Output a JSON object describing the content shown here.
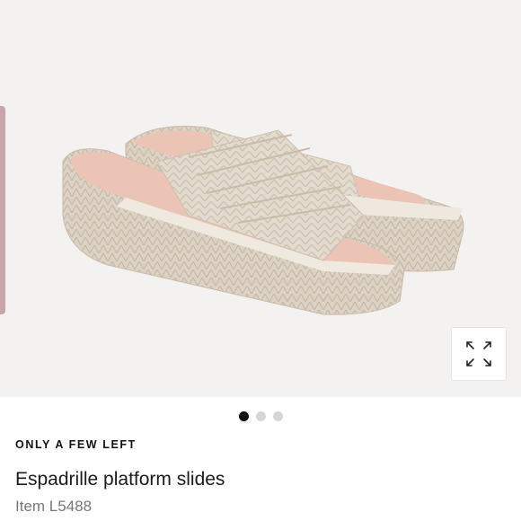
{
  "gallery": {
    "image_alt": "Espadrille platform slides",
    "zoom_icon": "expand-arrows-icon",
    "dots": [
      {
        "active": true
      },
      {
        "active": false
      },
      {
        "active": false
      }
    ]
  },
  "product": {
    "stock_label": "ONLY A FEW LEFT",
    "title": "Espadrille platform slides",
    "item_number": "Item L5488"
  },
  "colors": {
    "gallery_bg": "#f3f2f1",
    "jute": "#e3dace",
    "insole_pink": "#ebc4b5",
    "side_tab": "#c9a4a9"
  }
}
